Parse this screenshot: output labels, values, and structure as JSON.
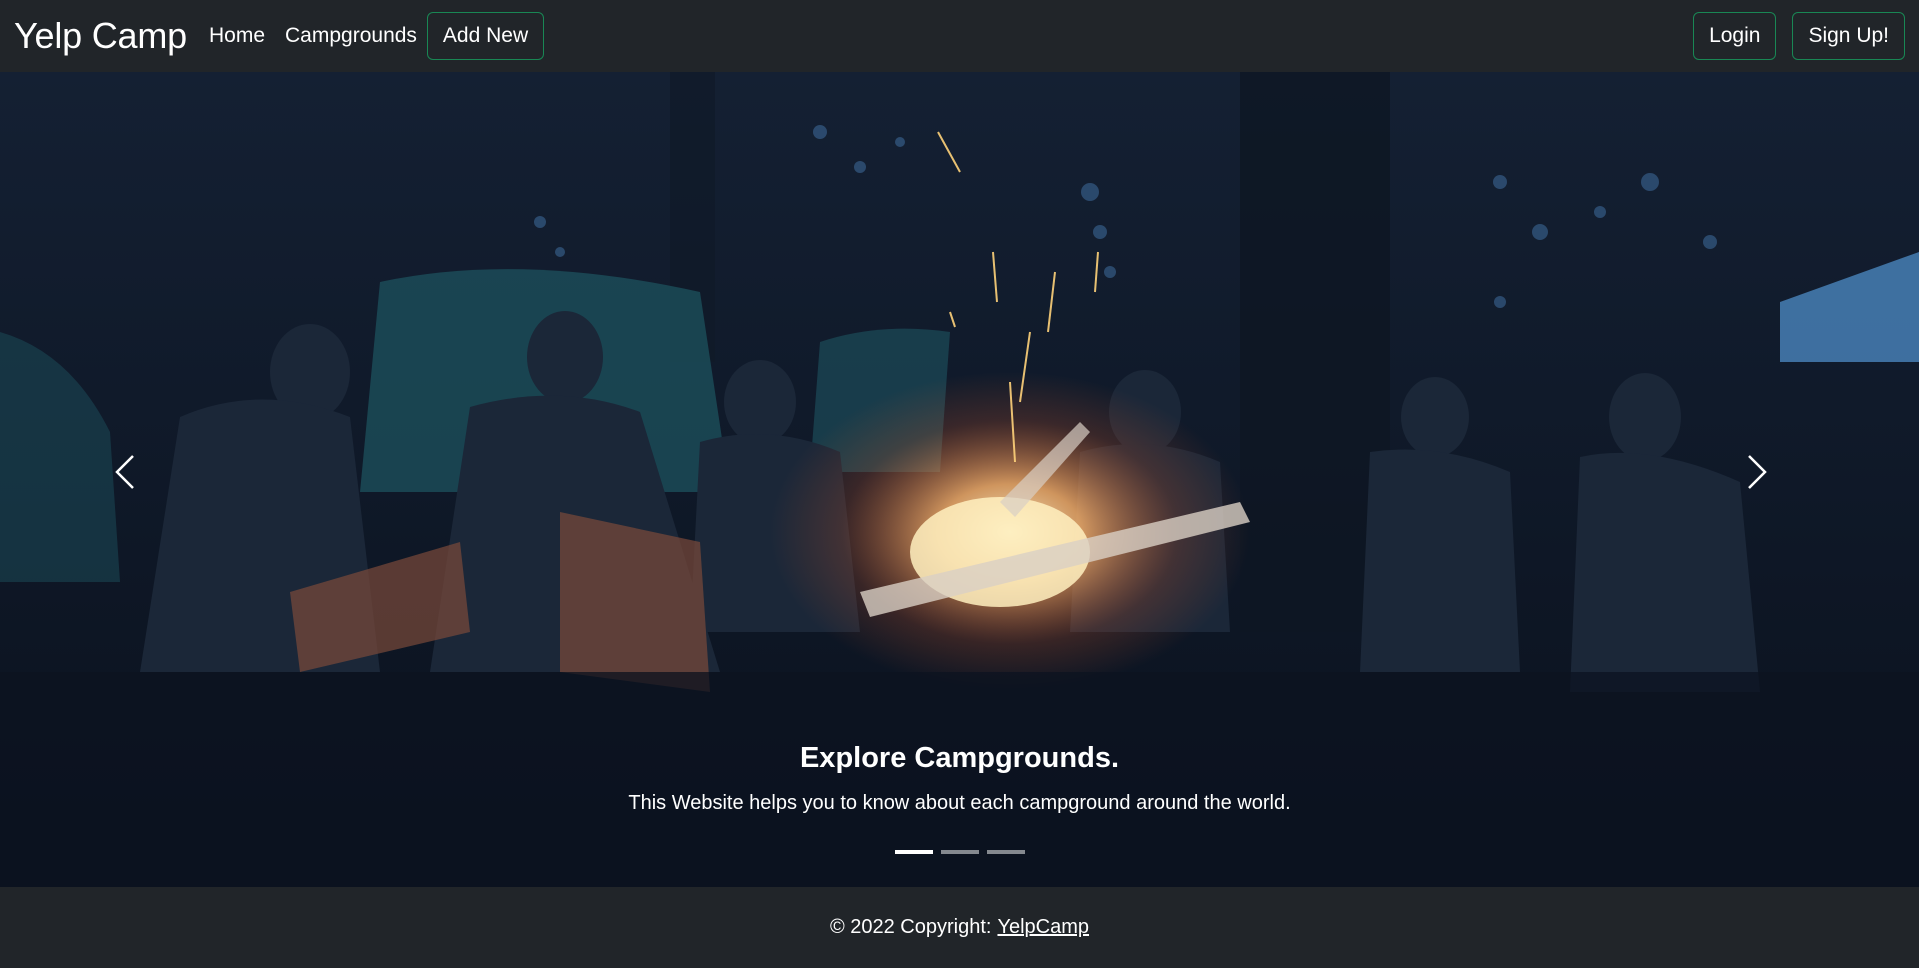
{
  "navbar": {
    "brand": "Yelp Camp",
    "links": [
      {
        "label": "Home"
      },
      {
        "label": "Campgrounds"
      }
    ],
    "add_new_label": "Add New",
    "login_label": "Login",
    "signup_label": "Sign Up!"
  },
  "carousel": {
    "slides": 3,
    "active_index": 0,
    "caption_title": "Explore Campgrounds.",
    "caption_text": "This Website helps you to know about each campground around the world.",
    "prev_icon": "chevron-left-icon",
    "next_icon": "chevron-right-icon"
  },
  "footer": {
    "copyright_prefix": "© 2022 Copyright:",
    "copyright_link": "YelpCamp"
  },
  "colors": {
    "navbar_bg": "#212529",
    "accent": "#198754",
    "hero_dark": "#0b1422",
    "fire": "#ffb46b"
  }
}
